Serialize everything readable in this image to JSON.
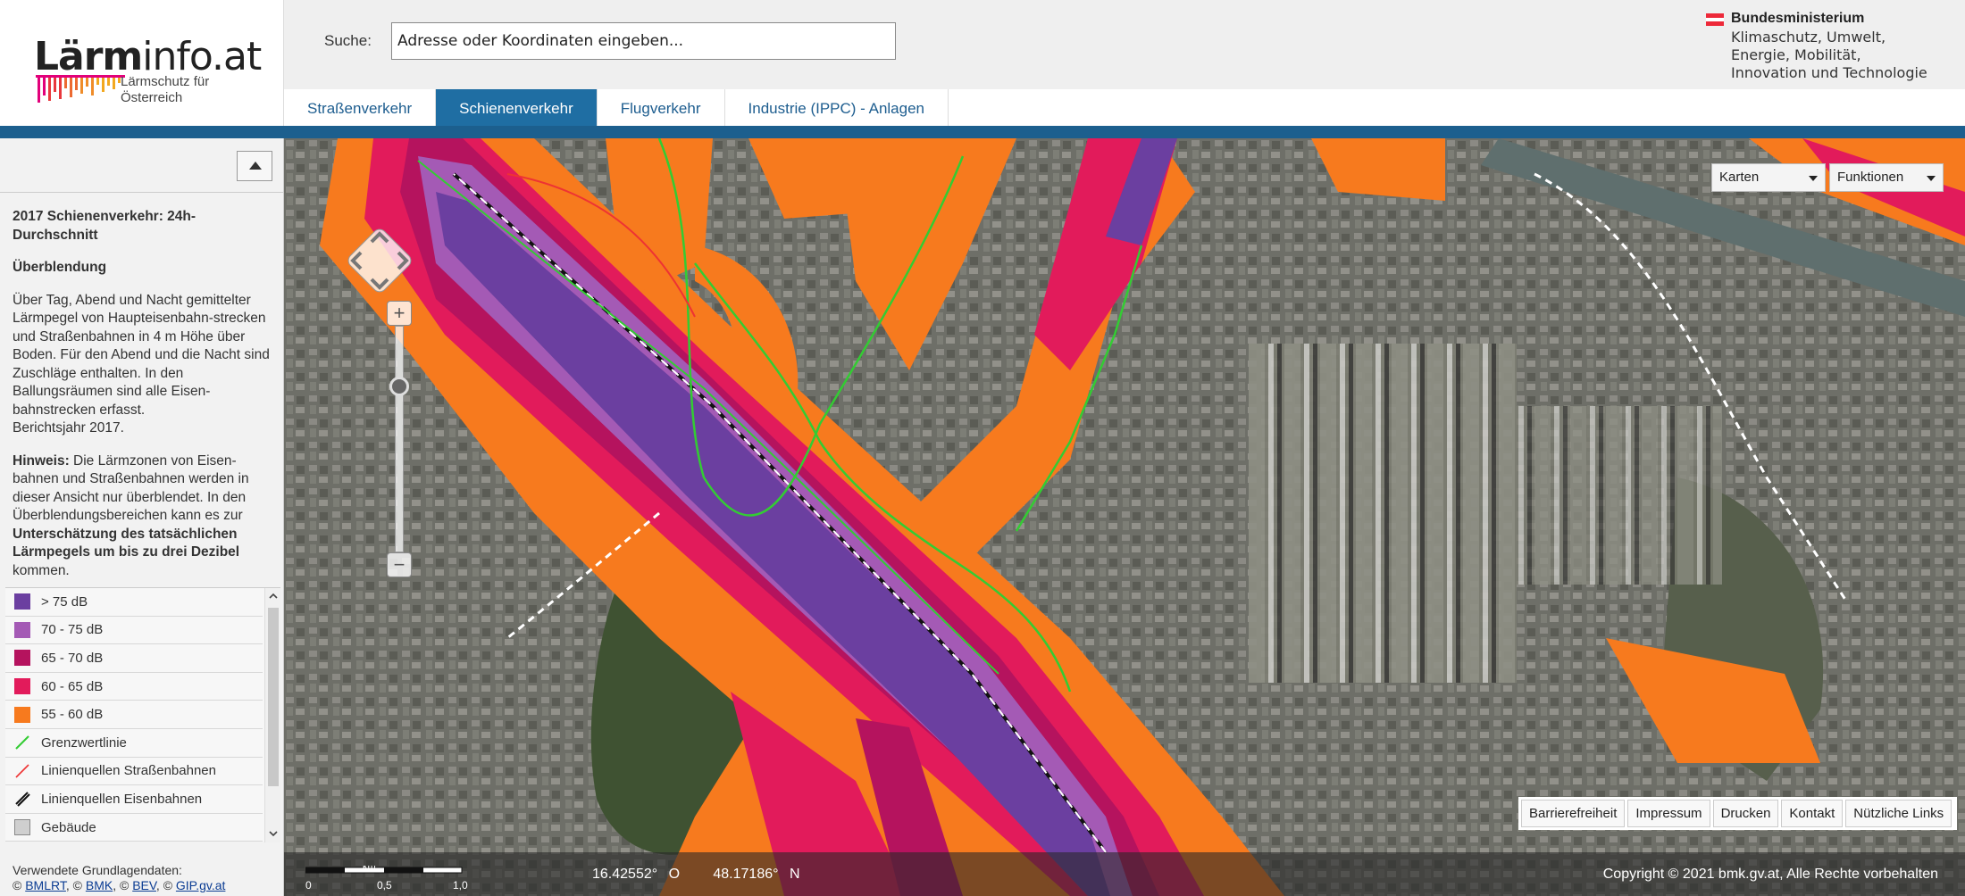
{
  "header": {
    "logo_prefix": "Lärm",
    "logo_suffix": "info.at",
    "logo_subtitle_1": "Lärmschutz für",
    "logo_subtitle_2": "Österreich",
    "search_label": "Suche:",
    "search_value": "Adresse oder Koordinaten eingeben...",
    "ministry_name": "Bundesministerium",
    "ministry_line_1": "Klimaschutz, Umwelt,",
    "ministry_line_2": "Energie, Mobilität,",
    "ministry_line_3": "Innovation und Technologie",
    "flag_colors": [
      "#ed2939",
      "#ffffff",
      "#ed2939"
    ]
  },
  "tabs": [
    {
      "label": "Straßenverkehr",
      "active": false
    },
    {
      "label": "Schienenverkehr",
      "active": true
    },
    {
      "label": "Flugverkehr",
      "active": false
    },
    {
      "label": "Industrie (IPPC) - Anlagen",
      "active": false
    }
  ],
  "panel": {
    "collapse_icon": "triangle-up-icon",
    "title": "2017 Schienenverkehr: 24h-Durchschnitt",
    "subtitle": "Überblendung",
    "description": "Über Tag, Abend und Nacht gemittelter Lärmpegel von Haupteisenbahn-strecken und Straßenbahnen in 4 m Höhe über Boden. Für den Abend und die Nacht sind Zuschläge enthalten. In den Ballungsräumen sind alle Eisen-bahnstrecken erfasst.",
    "report_year": "Berichtsjahr 2017.",
    "hint_label": "Hinweis:",
    "hint_text_1": " Die Lärmzonen von Eisen-bahnen und Straßenbahnen werden in dieser Ansicht nur überblendet. In den Überblendungsbereichen kann es zur ",
    "hint_bold": "Unterschätzung des tatsächlichen Lärmpegels um bis zu drei Dezibel",
    "hint_text_2": " kommen.",
    "credits_title": "Verwendete Grundlagendaten:",
    "credits": [
      "BMLRT",
      "BMK",
      "BEV",
      "GIP.gv.at"
    ]
  },
  "legend": [
    {
      "label": "> 75 dB",
      "color": "#6b3fa0",
      "kind": "box"
    },
    {
      "label": "70 - 75 dB",
      "color": "#a45ab5",
      "kind": "box"
    },
    {
      "label": "65 - 70 dB",
      "color": "#b5135e",
      "kind": "box"
    },
    {
      "label": "60 - 65 dB",
      "color": "#e21b5b",
      "kind": "box"
    },
    {
      "label": "55 - 60 dB",
      "color": "#f77a1e",
      "kind": "box"
    },
    {
      "label": "Grenzwertlinie",
      "color": "#33cc33",
      "kind": "line"
    },
    {
      "label": "Linienquellen Straßenbahnen",
      "color": "#e33",
      "kind": "line"
    },
    {
      "label": "Linienquellen Eisenbahnen",
      "color": "#111",
      "kind": "rail"
    },
    {
      "label": "Gebäude",
      "color": "#cfcfcf",
      "kind": "box"
    }
  ],
  "map": {
    "layer_select": "Karten",
    "functions_select": "Funktionen",
    "footer_links": [
      "Barrierefreiheit",
      "Impressum",
      "Drucken",
      "Kontakt",
      "Nützliche Links"
    ],
    "scale_labels": [
      "0",
      "0,5",
      "1,0"
    ],
    "scale_unit": "km",
    "coord_lon": "16.42552° O",
    "coord_lat": "48.17186° N",
    "copyright": "Copyright © 2021 bmk.gv.at, Alle Rechte vorbehalten"
  }
}
